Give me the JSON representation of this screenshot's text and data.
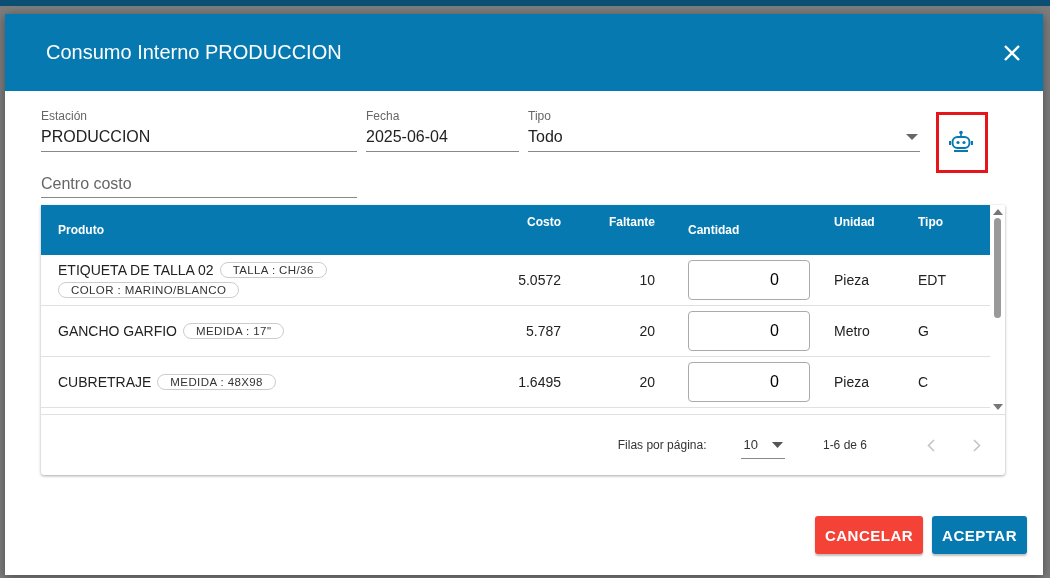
{
  "dialog": {
    "title": "Consumo Interno PRODUCCION"
  },
  "fields": [
    {
      "label": "Estación",
      "value": "PRODUCCION",
      "kind": "text"
    },
    {
      "label": "Fecha",
      "value": "2025-06-04",
      "kind": "text"
    },
    {
      "label": "Tipo",
      "value": "Todo",
      "kind": "select"
    }
  ],
  "cost_center": {
    "placeholder": "Centro costo"
  },
  "table": {
    "columns": [
      "Produto",
      "Costo",
      "Faltante",
      "Cantidad",
      "Unidad",
      "Tipo"
    ],
    "rows": [
      {
        "product": "ETIQUETA DE TALLA 02",
        "tags": [
          "TALLA : CH/36",
          "COLOR : MARINO/BLANCO"
        ],
        "cost": "5.0572",
        "missing": "10",
        "quantity": "0",
        "unit": "Pieza",
        "type": "EDT"
      },
      {
        "product": "GANCHO GARFIO",
        "tags": [
          "MEDIDA : 17\""
        ],
        "cost": "5.787",
        "missing": "20",
        "quantity": "0",
        "unit": "Metro",
        "type": "G"
      },
      {
        "product": "CUBRETRAJE",
        "tags": [
          "MEDIDA : 48X98"
        ],
        "cost": "1.6495",
        "missing": "20",
        "quantity": "0",
        "unit": "Pieza",
        "type": "C"
      }
    ]
  },
  "pagination": {
    "rows_label": "Filas por página:",
    "rows_per_page": "10",
    "range": "1-6 de 6",
    "prev_disabled": true,
    "next_disabled": true
  },
  "buttons": [
    {
      "label": "CANCELAR",
      "kind": "danger"
    },
    {
      "label": "ACEPTAR",
      "kind": "primary"
    }
  ]
}
